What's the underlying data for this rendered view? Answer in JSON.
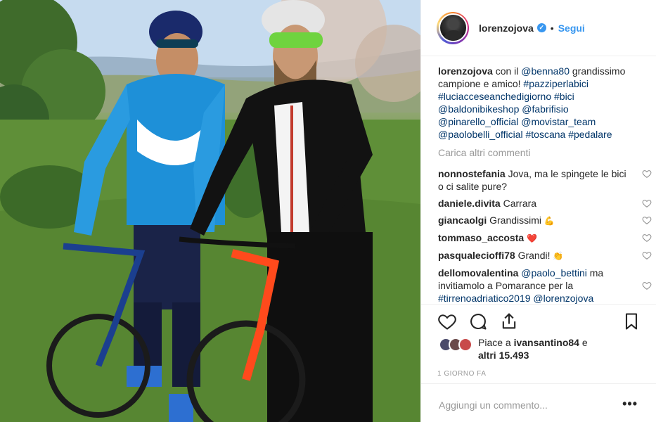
{
  "post": {
    "username": "lorenzojova",
    "verified_mark": "✓",
    "separator": "•",
    "follow_label": "Segui"
  },
  "caption": {
    "author": "lorenzojova",
    "text_1": "con il",
    "mention_benna": "@benna80",
    "text_2": "grandissimo campione e amico!",
    "tags": [
      "#pazziperlabici",
      "#luciacceseanchedigiorno",
      "#bici",
      "@baldonibikeshop",
      "@fabrifisio",
      "@pinarello_official",
      "@movistar_team",
      "@paolobelli_official",
      "#toscana",
      "#pedalare"
    ]
  },
  "load_more_label": "Carica altri commenti",
  "comments": [
    {
      "user": "nonnostefania",
      "text": "Jova, ma le spingete le bici o ci salite pure?"
    },
    {
      "user": "daniele.divita",
      "text": "Carrara"
    },
    {
      "user": "giancaolgi",
      "text": "Grandissimi",
      "emoji": "💪"
    },
    {
      "user": "tommaso_accosta",
      "text": "",
      "emoji": "❤️"
    },
    {
      "user": "pasqualecioffi78",
      "text": "Grandi!",
      "emoji": "👏"
    },
    {
      "user": "dellomovalentina",
      "mention": "@paolo_bettini",
      "text_a": "ma invitiamolo a Pomarance per la",
      "tag": "#tirrenoadriatico2019",
      "mention2": "@lorenzojova"
    }
  ],
  "likes": {
    "prefix": "Piace a",
    "user": "ivansantino84",
    "joiner": "e",
    "others": "altri 15.493"
  },
  "timestamp": "1 GIORNO FA",
  "add_comment_placeholder": "Aggiungi un commento...",
  "more_options": "•••",
  "colors": {
    "accent": "#3897f0",
    "link": "#003569",
    "muted": "#999999",
    "heart": "#ed4956"
  }
}
